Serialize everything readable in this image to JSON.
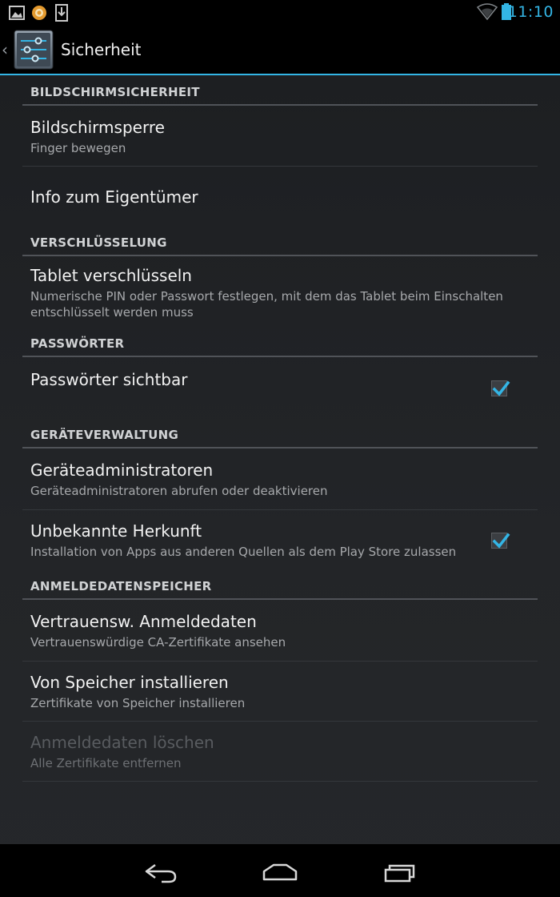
{
  "status_bar": {
    "time": "11:10",
    "icons": [
      "gallery-notification-icon",
      "app-notification-icon",
      "download-notification-icon",
      "wifi-icon",
      "battery-icon"
    ]
  },
  "action_bar": {
    "title": "Sicherheit",
    "icon": "settings-sliders-icon"
  },
  "sections": [
    {
      "header": "BILDSCHIRMSICHERHEIT",
      "items": [
        {
          "title": "Bildschirmsperre",
          "summary": "Finger bewegen"
        },
        {
          "title": "Info zum Eigentümer",
          "summary": ""
        }
      ]
    },
    {
      "header": "VERSCHLÜSSELUNG",
      "items": [
        {
          "title": "Tablet verschlüsseln",
          "summary": "Numerische PIN oder Passwort festlegen, mit dem das Tablet beim Einschalten entschlüsselt werden muss"
        }
      ]
    },
    {
      "header": "PASSWÖRTER",
      "items": [
        {
          "title": "Passwörter sichtbar",
          "summary": "",
          "checked": true
        }
      ]
    },
    {
      "header": "GERÄTEVERWALTUNG",
      "items": [
        {
          "title": "Geräteadministratoren",
          "summary": "Geräteadministratoren abrufen oder deaktivieren"
        },
        {
          "title": "Unbekannte Herkunft",
          "summary": "Installation von Apps aus anderen Quellen als dem Play Store zulassen",
          "checked": true
        }
      ]
    },
    {
      "header": "ANMELDEDATENSPEICHER",
      "items": [
        {
          "title": "Vertrauensw. Anmeldedaten",
          "summary": "Vertrauenswürdige CA-Zertifikate ansehen"
        },
        {
          "title": "Von Speicher installieren",
          "summary": "Zertifikate von Speicher installieren"
        },
        {
          "title": "Anmeldedaten löschen",
          "summary": "Alle Zertifikate entfernen",
          "enabled": false
        }
      ]
    }
  ],
  "nav_bar": {
    "buttons": [
      "back-icon",
      "home-icon",
      "recent-apps-icon"
    ]
  },
  "colors": {
    "accent": "#33b5e5",
    "background": "#222427",
    "divider": "#505358",
    "checkbox_tick": "#33b5e5"
  }
}
